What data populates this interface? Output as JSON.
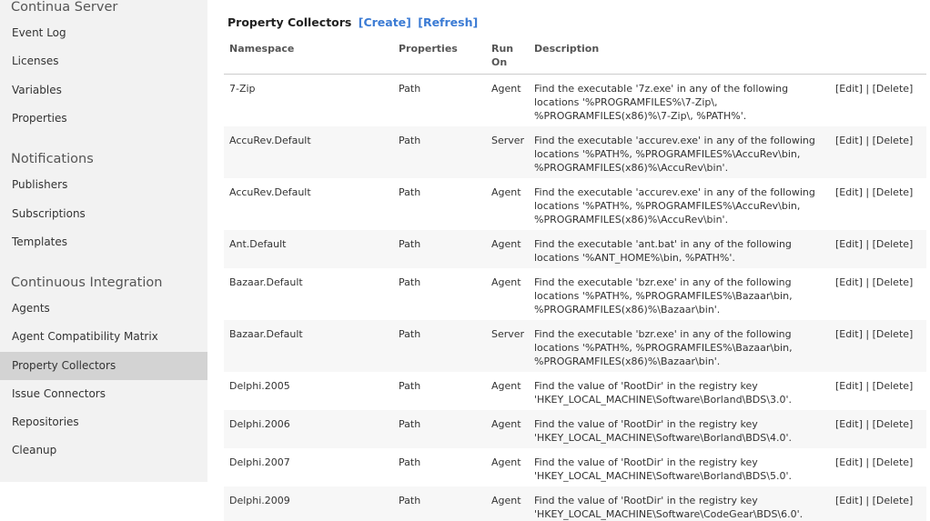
{
  "sidebar": {
    "section1_title": "Continua Server",
    "section1_items": [
      "Event Log",
      "Licenses",
      "Variables",
      "Properties"
    ],
    "section2_title": "Notifications",
    "section2_items": [
      "Publishers",
      "Subscriptions",
      "Templates"
    ],
    "section3_title": "Continuous Integration",
    "section3_items": [
      "Agents",
      "Agent Compatibility Matrix",
      "Property Collectors",
      "Issue Connectors",
      "Repositories",
      "Cleanup"
    ],
    "active_item": "Property Collectors"
  },
  "page": {
    "title": "Property Collectors",
    "create_link": "[Create]",
    "refresh_link": "[Refresh]"
  },
  "table": {
    "headers": {
      "namespace": "Namespace",
      "properties": "Properties",
      "run_on_1": "Run",
      "run_on_2": "On",
      "description": "Description"
    },
    "edit_label": "[Edit]",
    "separator": " | ",
    "delete_label": "[Delete]",
    "rows": [
      {
        "namespace": "7-Zip",
        "properties": "Path",
        "run_on": "Agent",
        "description": "Find the executable '7z.exe' in any of the following locations '%PROGRAMFILES%\\7-Zip\\, %PROGRAMFILES(x86)%\\7-Zip\\, %PATH%'."
      },
      {
        "namespace": "AccuRev.Default",
        "properties": "Path",
        "run_on": "Server",
        "description": "Find the executable 'accurev.exe' in any of the following locations '%PATH%, %PROGRAMFILES%\\AccuRev\\bin, %PROGRAMFILES(x86)%\\AccuRev\\bin'."
      },
      {
        "namespace": "AccuRev.Default",
        "properties": "Path",
        "run_on": "Agent",
        "description": "Find the executable 'accurev.exe' in any of the following locations '%PATH%, %PROGRAMFILES%\\AccuRev\\bin, %PROGRAMFILES(x86)%\\AccuRev\\bin'."
      },
      {
        "namespace": "Ant.Default",
        "properties": "Path",
        "run_on": "Agent",
        "description": "Find the executable 'ant.bat' in any of the following locations '%ANT_HOME%\\bin, %PATH%'."
      },
      {
        "namespace": "Bazaar.Default",
        "properties": "Path",
        "run_on": "Agent",
        "description": "Find the executable 'bzr.exe' in any of the following locations '%PATH%, %PROGRAMFILES%\\Bazaar\\bin, %PROGRAMFILES(x86)%\\Bazaar\\bin'."
      },
      {
        "namespace": "Bazaar.Default",
        "properties": "Path",
        "run_on": "Server",
        "description": "Find the executable 'bzr.exe' in any of the following locations '%PATH%, %PROGRAMFILES%\\Bazaar\\bin, %PROGRAMFILES(x86)%\\Bazaar\\bin'."
      },
      {
        "namespace": "Delphi.2005",
        "properties": "Path",
        "run_on": "Agent",
        "description": "Find the value of 'RootDir' in the registry key 'HKEY_LOCAL_MACHINE\\Software\\Borland\\BDS\\3.0'."
      },
      {
        "namespace": "Delphi.2006",
        "properties": "Path",
        "run_on": "Agent",
        "description": "Find the value of 'RootDir' in the registry key 'HKEY_LOCAL_MACHINE\\Software\\Borland\\BDS\\4.0'."
      },
      {
        "namespace": "Delphi.2007",
        "properties": "Path",
        "run_on": "Agent",
        "description": "Find the value of 'RootDir' in the registry key 'HKEY_LOCAL_MACHINE\\Software\\Borland\\BDS\\5.0'."
      },
      {
        "namespace": "Delphi.2009",
        "properties": "Path",
        "run_on": "Agent",
        "description": "Find the value of 'RootDir' in the registry key 'HKEY_LOCAL_MACHINE\\Software\\CodeGear\\BDS\\6.0'."
      }
    ]
  },
  "colors": {
    "accent_link": "#3b7bd4",
    "sidebar_bg": "#f2f2f2",
    "sidebar_active_bg": "#d3d3d3",
    "row_alt_bg": "#f7f7f7"
  }
}
